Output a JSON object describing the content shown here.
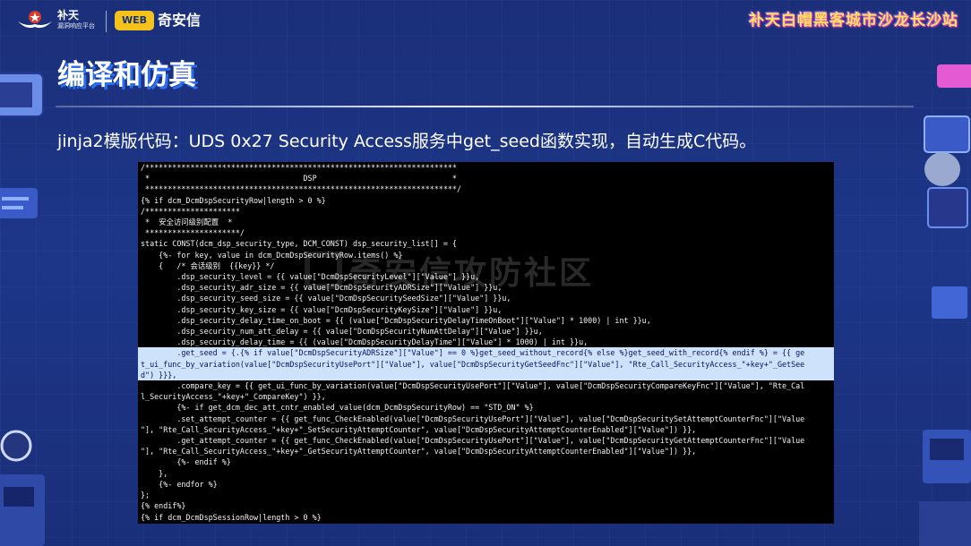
{
  "header": {
    "logo_butian_main": "补天",
    "logo_butian_sub": "漏洞响应平台",
    "logo_qax_badge": "WEB",
    "logo_qax_name": "奇安信",
    "event_title": "补天白帽黑客城市沙龙长沙站"
  },
  "slide": {
    "title": "编译和仿真",
    "subtitle": "jinja2模版代码：UDS 0x27 Security Access服务中get_seed函数实现，自动生成C代码。"
  },
  "watermark": "奇安信攻防社区",
  "colors": {
    "background": "#1d3688",
    "title_shadow": "#2a6df0",
    "event_title": "#ffe35a",
    "code_background": "#000000",
    "code_text": "#f3f3f3",
    "selection": "#cfe2fb"
  },
  "code": {
    "lines": [
      {
        "text": "/*********************************************************************",
        "hl": false
      },
      {
        "text": " *                                  DSP                              *",
        "hl": false
      },
      {
        "text": " *********************************************************************/",
        "hl": false
      },
      {
        "text": "{% if dcm_DcmDspSecurityRow|length > 0 %}",
        "hl": false
      },
      {
        "text": "/*********************",
        "hl": false
      },
      {
        "text": " *  安全访问级别配置  *",
        "hl": false
      },
      {
        "text": " *********************/",
        "hl": false
      },
      {
        "text": "static CONST(dcm_dsp_security_type, DCM_CONST) dsp_security_list[] = {",
        "hl": false
      },
      {
        "text": "    {%- for key, value in dcm_DcmDspSecurityRow.items() %}",
        "hl": false
      },
      {
        "text": "    {   /* 会话级别  {{key}} */",
        "hl": false
      },
      {
        "text": "        .dsp_security_level = {{ value[\"DcmDspSecurityLevel\"][\"Value\"] }}u,",
        "hl": false
      },
      {
        "text": "        .dsp_security_adr_size = {{ value[\"DcmDspSecurityADRSize\"][\"Value\"] }}u,",
        "hl": false
      },
      {
        "text": "        .dsp_security_seed_size = {{ value[\"DcmDspSecuritySeedSize\"][\"Value\"] }}u,",
        "hl": false
      },
      {
        "text": "        .dsp_security_key_size = {{ value[\"DcmDspSecurityKeySize\"][\"Value\"] }}u,",
        "hl": false
      },
      {
        "text": "        .dsp_security_delay_time_on_boot = {{ (value[\"DcmDspSecurityDelayTimeOnBoot\"][\"Value\"] * 1000) | int }}u,",
        "hl": false
      },
      {
        "text": "        .dsp_security_num_att_delay = {{ value[\"DcmDspSecurityNumAttDelay\"][\"Value\"] }}u,",
        "hl": false
      },
      {
        "text": "        .dsp_security_delay_time = {{ (value[\"DcmDspSecurityDelayTime\"][\"Value\"] * 1000) | int }}u,",
        "hl": false
      },
      {
        "text": "        .get_seed = {.{% if value[\"DcmDspSecurityADRSize\"][\"Value\"] == 0 %}get_seed_without_record{% else %}get_seed_with_record{% endif %} = {{ ge",
        "hl": true
      },
      {
        "text": "t_ui_func_by_variation(value[\"DcmDspSecurityUsePort\"][\"Value\"], value[\"DcmDspSecurityGetSeedFnc\"][\"Value\"], \"Rte_Call_SecurityAccess_\"+key+\"_GetSee",
        "hl": true
      },
      {
        "text": "d\") }}},",
        "hl": true
      },
      {
        "text": "        .compare_key = {{ get_ui_func_by_variation(value[\"DcmDspSecurityUsePort\"][\"Value\"], value[\"DcmDspSecurityCompareKeyFnc\"][\"Value\"], \"Rte_Cal",
        "hl": false
      },
      {
        "text": "l_SecurityAccess_\"+key+\"_CompareKey\") }},",
        "hl": false
      },
      {
        "text": "        {%- if get_dcm_dec_att_cntr_enabled_value(dcm_DcmDspSecurityRow) == \"STD_ON\" %}",
        "hl": false
      },
      {
        "text": "        .set_attempt_counter = {{ get_func_CheckEnabled(value[\"DcmDspSecurityUsePort\"][\"Value\"], value[\"DcmDspSecuritySetAttemptCounterFnc\"][\"Value",
        "hl": false
      },
      {
        "text": "\"], \"Rte_Call_SecurityAccess_\"+key+\"_SetSecurityAttemptCounter\", value[\"DcmDspSecurityAttemptCounterEnabled\"][\"Value\"]) }},",
        "hl": false
      },
      {
        "text": "        .get_attempt_counter = {{ get_func_CheckEnabled(value[\"DcmDspSecurityUsePort\"][\"Value\"], value[\"DcmDspSecurityGetAttemptCounterFnc\"][\"Value",
        "hl": false
      },
      {
        "text": "\"], \"Rte_Call_SecurityAccess_\"+key+\"_GetSecurityAttemptCounter\", value[\"DcmDspSecurityAttemptCounterEnabled\"][\"Value\"]) }},",
        "hl": false
      },
      {
        "text": "        {%- endif %}",
        "hl": false
      },
      {
        "text": "    },",
        "hl": false
      },
      {
        "text": "    {%- endfor %}",
        "hl": false
      },
      {
        "text": "};",
        "hl": false
      },
      {
        "text": "{% endif%}",
        "hl": false
      },
      {
        "text": "{% if dcm_DcmDspSessionRow|length > 0 %}",
        "hl": false
      }
    ]
  }
}
